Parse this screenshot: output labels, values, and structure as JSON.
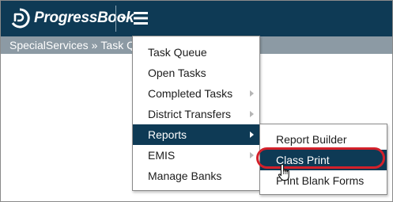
{
  "app": {
    "logo_text": "ProgressBook"
  },
  "breadcrumb": {
    "part1": "SpecialServices",
    "separator": "»",
    "part2": "Task Qu"
  },
  "menu": {
    "items": [
      {
        "label": "Task Queue",
        "has_submenu": false
      },
      {
        "label": "Open Tasks",
        "has_submenu": false
      },
      {
        "label": "Completed Tasks",
        "has_submenu": true
      },
      {
        "label": "District Transfers",
        "has_submenu": true
      },
      {
        "label": "Reports",
        "has_submenu": true,
        "active": true
      },
      {
        "label": "EMIS",
        "has_submenu": true
      },
      {
        "label": "Manage Banks",
        "has_submenu": false
      }
    ]
  },
  "submenu": {
    "items": [
      {
        "label": "Report Builder"
      },
      {
        "label": "Class Print",
        "highlighted": true
      },
      {
        "label": "Print Blank Forms"
      }
    ]
  },
  "colors": {
    "topbar": "#0e3a55",
    "breadcrumb_bar": "#8c9aa4",
    "active_item": "#0e3a55",
    "highlight_ring": "#d3202a"
  },
  "icons": {
    "logo": "progressbook-logo-icon",
    "caret": "caret-down-icon",
    "menu": "hamburger-menu-icon",
    "cursor": "hand-pointer-cursor-icon"
  }
}
